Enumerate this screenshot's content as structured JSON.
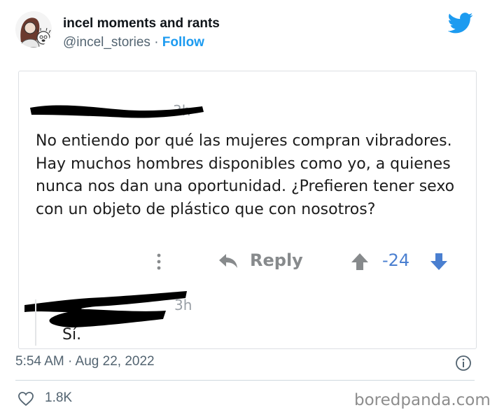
{
  "tweet": {
    "account_name": "incel moments and rants",
    "handle": "@incel_stories",
    "separator": "·",
    "follow_label": "Follow",
    "timestamp": "5:54 AM · Aug 22, 2022",
    "likes": "1.8K"
  },
  "reddit_comment": {
    "time_ghost": "3h",
    "body": "No entiendo por qué las mujeres compran vibradores. Hay muchos hombres disponibles como yo, a quienes nunca nos dan una oportunidad. ¿Prefieren tener sexo con un objeto de plástico que con nosotros?",
    "reply_label": "Reply",
    "score": "-24",
    "reply_time_ghost": "3h",
    "reply_body": "Sí."
  },
  "watermark": "boredpanda.com",
  "colors": {
    "twitter_blue": "#1d9bf0",
    "vote_blue": "#4a7fd0",
    "muted_gray": "#536471"
  },
  "icons": [
    "avatar",
    "twitter-bird-icon",
    "more-dots-icon",
    "reply-arrow-icon",
    "upvote-icon",
    "downvote-icon",
    "info-icon",
    "heart-icon"
  ]
}
